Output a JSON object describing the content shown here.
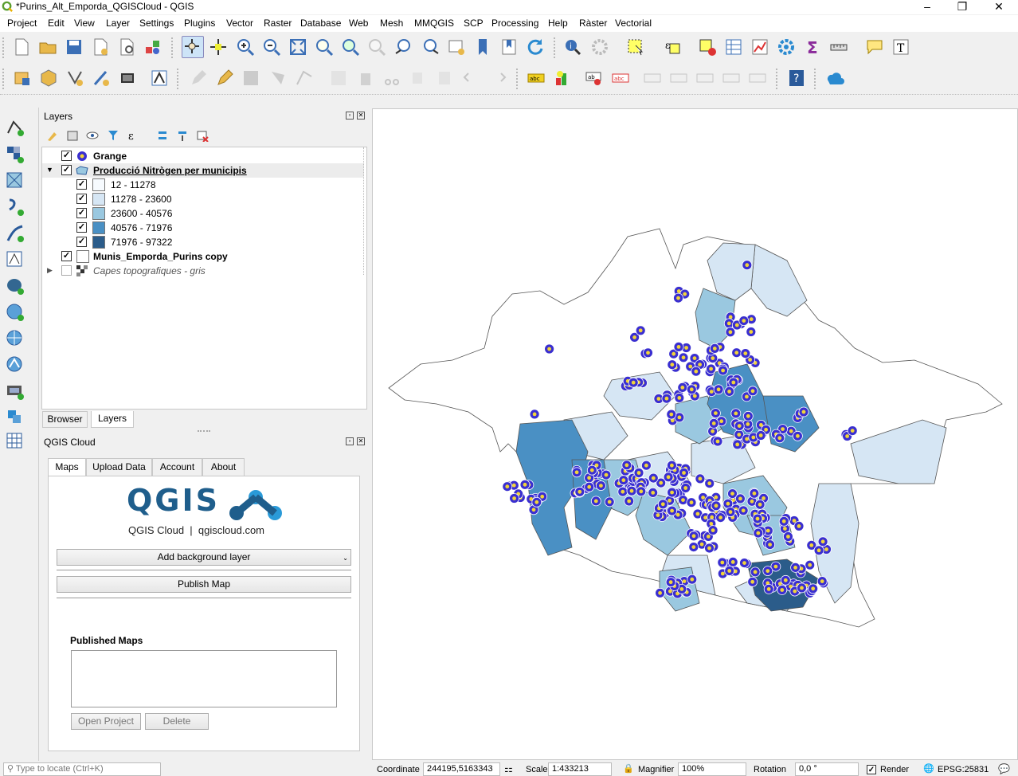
{
  "window": {
    "title": "*Purins_Alt_Emporda_QGISCloud - QGIS"
  },
  "menu": [
    "Project",
    "Edit",
    "View",
    "Layer",
    "Settings",
    "Plugins",
    "Vector",
    "Raster",
    "Database",
    "Web",
    "Mesh",
    "MMQGIS",
    "SCP",
    "Processing",
    "Help",
    "Ràster",
    "Vectorial"
  ],
  "layers_panel": {
    "title": "Layers",
    "layers": [
      {
        "name": "Grange",
        "checked": true
      },
      {
        "name": "Producció Nitrògen per municipis",
        "checked": true,
        "expanded": true,
        "legend": [
          {
            "label": "12 - 11278",
            "color": "#f7fbff"
          },
          {
            "label": "11278 - 23600",
            "color": "#d6e6f4"
          },
          {
            "label": "23600 - 40576",
            "color": "#9ac8e0"
          },
          {
            "label": "40576 - 71976",
            "color": "#4a90c4"
          },
          {
            "label": "71976 - 97322",
            "color": "#2b5c8a"
          }
        ]
      },
      {
        "name": "Munis_Emporda_Purins copy",
        "checked": true
      },
      {
        "name": "Capes topografiques - gris",
        "checked": false
      }
    ],
    "tabs": [
      "Browser",
      "Layers"
    ],
    "active_tab": "Layers"
  },
  "cloud_panel": {
    "title": "QGIS Cloud",
    "tabs": [
      "Maps",
      "Upload Data",
      "Account",
      "About"
    ],
    "logo_text": "QGIS",
    "logo_sub": "QGIS Cloud  |  qgiscloud.com",
    "add_background_label": "Add background layer",
    "publish_label": "Publish Map",
    "published_maps_label": "Published Maps",
    "open_project_label": "Open Project",
    "delete_label": "Delete"
  },
  "status": {
    "locate_placeholder": "Type to locate (Ctrl+K)",
    "coordinate_label": "Coordinate",
    "coordinate_value": "244195,5163343",
    "scale_label": "Scale",
    "scale_value": "1:433213",
    "magnifier_label": "Magnifier",
    "magnifier_value": "100%",
    "rotation_label": "Rotation",
    "rotation_value": "0,0 °",
    "render_label": "Render",
    "crs": "EPSG:25831"
  },
  "colors": {
    "marker_fill": "#3a2fd0",
    "marker_center": "#f2d43a",
    "border": "#555555"
  }
}
